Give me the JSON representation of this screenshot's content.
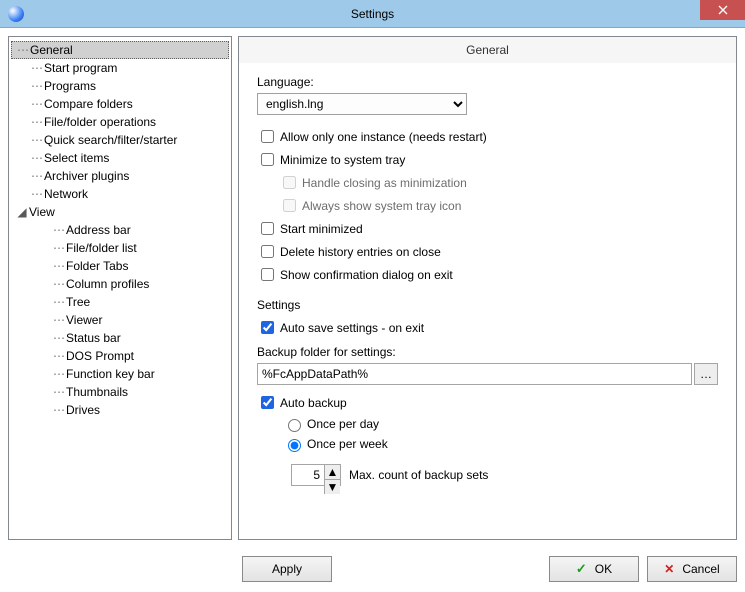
{
  "window": {
    "title": "Settings"
  },
  "tree": {
    "items": [
      {
        "label": "General",
        "lvl": 1,
        "selected": true
      },
      {
        "label": "Start program",
        "lvl": 1
      },
      {
        "label": "Programs",
        "lvl": 1
      },
      {
        "label": "Compare folders",
        "lvl": 1
      },
      {
        "label": "File/folder operations",
        "lvl": 1
      },
      {
        "label": "Quick search/filter/starter",
        "lvl": 1
      },
      {
        "label": "Select items",
        "lvl": 1
      },
      {
        "label": "Archiver plugins",
        "lvl": 1
      },
      {
        "label": "Network",
        "lvl": 1
      },
      {
        "label": "View",
        "lvl": 1,
        "expandable": true
      },
      {
        "label": "Address bar",
        "lvl": 2
      },
      {
        "label": "File/folder list",
        "lvl": 2
      },
      {
        "label": "Folder Tabs",
        "lvl": 2
      },
      {
        "label": "Column profiles",
        "lvl": 2
      },
      {
        "label": "Tree",
        "lvl": 2
      },
      {
        "label": "Viewer",
        "lvl": 2
      },
      {
        "label": "Status bar",
        "lvl": 2
      },
      {
        "label": "DOS Prompt",
        "lvl": 2
      },
      {
        "label": "Function key bar",
        "lvl": 2
      },
      {
        "label": "Thumbnails",
        "lvl": 2
      },
      {
        "label": "Drives",
        "lvl": 2
      }
    ]
  },
  "panel": {
    "header": "General",
    "language_label": "Language:",
    "language_value": "english.lng",
    "cb_one_instance": "Allow only one instance (needs restart)",
    "cb_minimize_tray": "Minimize to system tray",
    "cb_handle_closing": "Handle closing as minimization",
    "cb_always_tray_icon": "Always show system tray icon",
    "cb_start_minimized": "Start minimized",
    "cb_delete_history": "Delete history entries on close",
    "cb_show_confirm_exit": "Show confirmation dialog on exit",
    "settings_label": "Settings",
    "cb_auto_save": "Auto save settings - on exit",
    "backup_label": "Backup folder for settings:",
    "backup_path": "%FcAppDataPath%",
    "cb_auto_backup": "Auto backup",
    "radio_once_day": "Once per day",
    "radio_once_week": "Once per week",
    "spinner_value": "5",
    "spinner_label": "Max. count of backup sets"
  },
  "footer": {
    "apply": "Apply",
    "ok": "OK",
    "cancel": "Cancel"
  }
}
